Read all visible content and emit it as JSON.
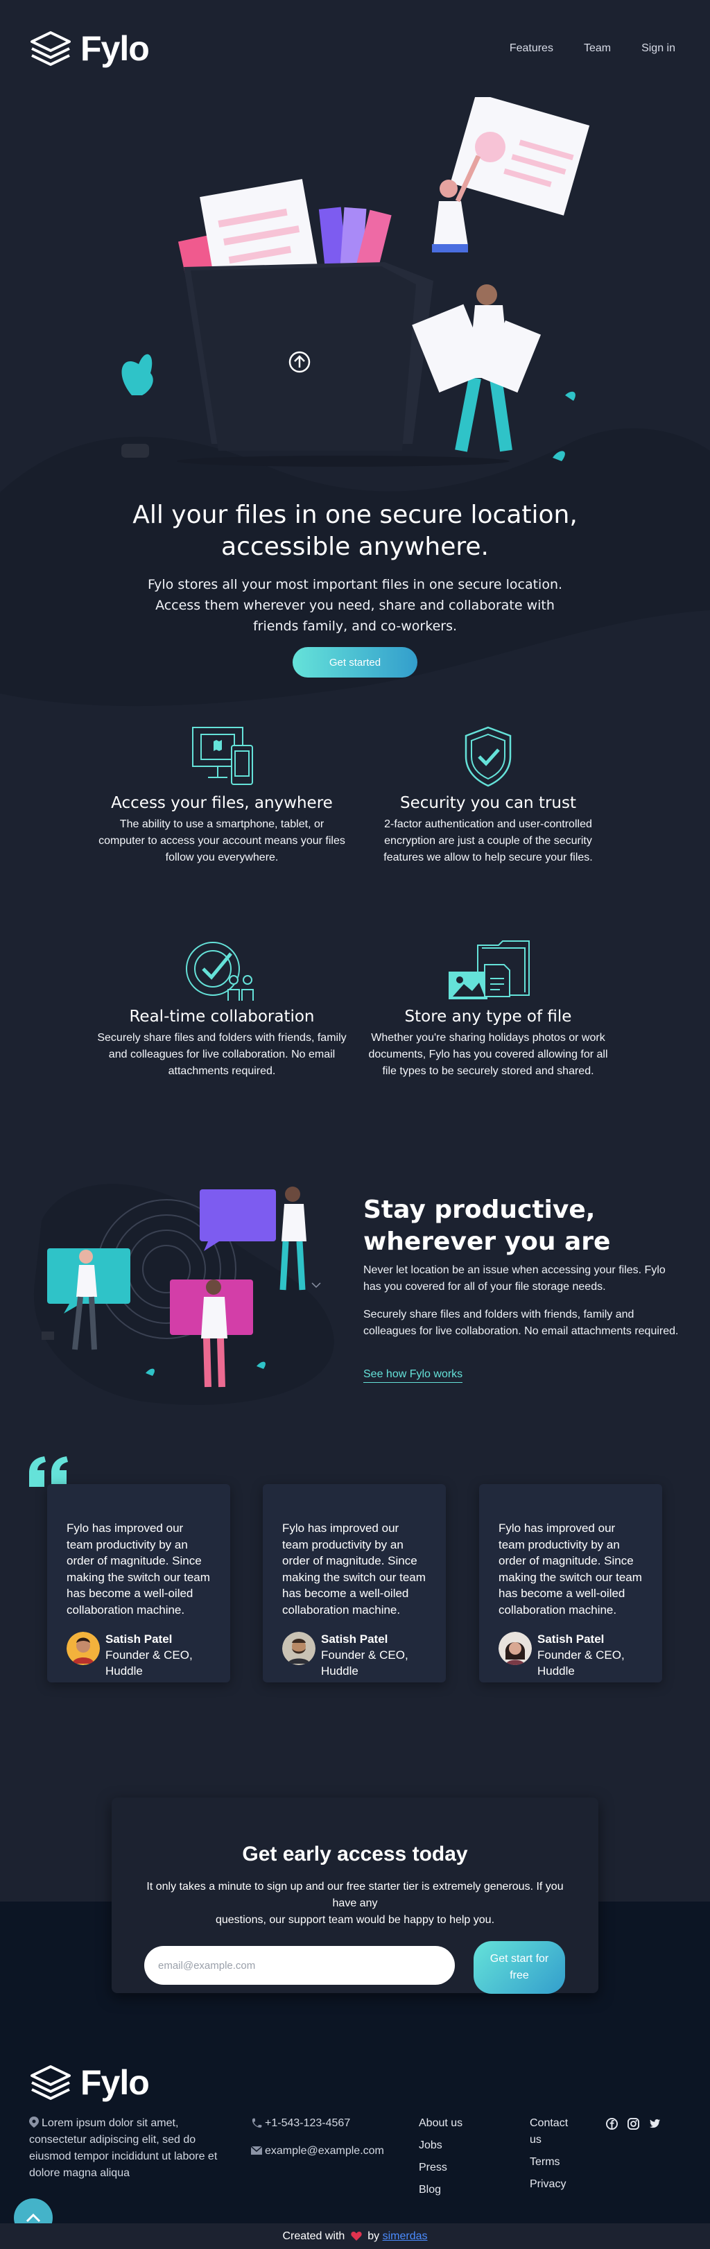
{
  "header": {
    "brand": "Fylo",
    "nav": [
      "Features",
      "Team",
      "Sign in"
    ]
  },
  "hero": {
    "title_line1": "All your files in one secure location,",
    "title_line2": "accessible anywhere.",
    "text": "Fylo stores all your most important files in one secure location. Access them wherever you need, share and collaborate with friends family, and co-workers.",
    "cta": "Get started"
  },
  "features": [
    {
      "title": "Access your files, anywhere",
      "text": "The ability to use a smartphone, tablet, or computer to access your account means your files follow you everywhere.",
      "icon": "devices-icon"
    },
    {
      "title": "Security you can trust",
      "text": "2-factor authentication and user-controlled encryption are just a couple of the security features we allow to help secure your files.",
      "icon": "shield-check-icon"
    },
    {
      "title": "Real-time collaboration",
      "text": "Securely share files and folders with friends, family and colleagues for live collaboration. No email attachments required.",
      "icon": "collaboration-icon"
    },
    {
      "title": "Store any type of file",
      "text": "Whether you're sharing holidays photos or work documents, Fylo has you covered allowing for all file types to be securely stored and shared.",
      "icon": "folder-files-icon"
    }
  ],
  "productive": {
    "title_line1": "Stay productive,",
    "title_line2": "wherever you are",
    "p1": "Never let location be an issue when accessing your files. Fylo has you covered for all of your file storage needs.",
    "p2": "Securely share files and folders with friends, family and colleagues for live collaboration. No email attachments required.",
    "link": "See how Fylo works"
  },
  "testimonials": [
    {
      "text": "Fylo has improved our team productivity by an order of magnitude. Since making the switch our team has become a well-oiled collaboration machine.",
      "name": "Satish Patel",
      "role": "Founder & CEO, Huddle"
    },
    {
      "text": "Fylo has improved our team productivity by an order of magnitude. Since making the switch our team has become a well-oiled collaboration machine.",
      "name": "Satish Patel",
      "role": "Founder & CEO, Huddle"
    },
    {
      "text": "Fylo has improved our team productivity by an order of magnitude. Since making the switch our team has become a well-oiled collaboration machine.",
      "name": "Satish Patel",
      "role": "Founder & CEO, Huddle"
    }
  ],
  "access": {
    "title": "Get early access today",
    "text_line1": "It only takes a minute to sign up and our free starter tier is extremely generous. If you have any",
    "text_line2": "questions, our support team would be happy to help you.",
    "placeholder": "email@example.com",
    "button": "Get start for free"
  },
  "footer": {
    "brand": "Fylo",
    "address": "Lorem ipsum dolor sit amet, consectetur adipiscing elit, sed do eiusmod tempor incididunt ut labore et dolore magna aliqua",
    "phone": "+1-543-123-4567",
    "email": "example@example.com",
    "links1": [
      "About us",
      "Jobs",
      "Press",
      "Blog"
    ],
    "links2": [
      "Contact us",
      "Terms",
      "Privacy"
    ],
    "credit_prefix": "Created with",
    "credit_by": "by",
    "credit_author": "simerdas"
  },
  "colors": {
    "background": "#1c2230",
    "footer": "#0c1524",
    "card": "#21293c",
    "accent": "#65e2d9",
    "accent_dark": "#339ecc"
  }
}
